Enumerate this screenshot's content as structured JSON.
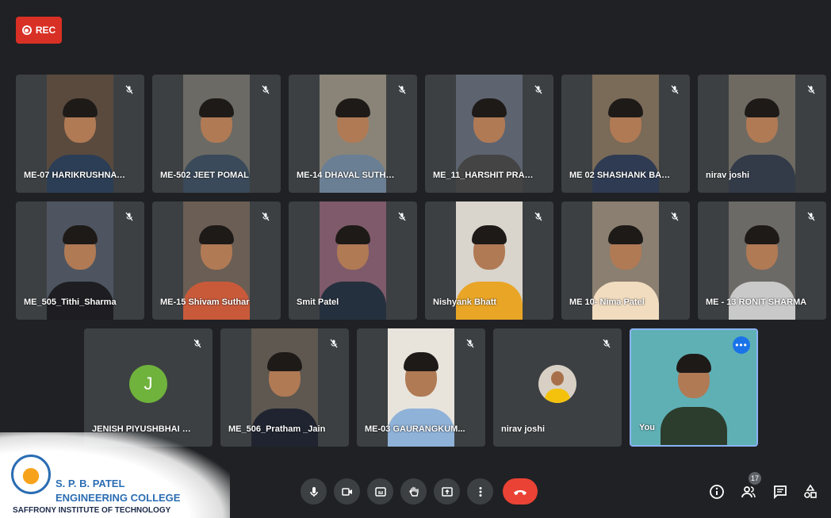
{
  "recording": {
    "label": "REC"
  },
  "participants": [
    {
      "name": "ME-07 HARIKRUSHNA ...",
      "muted": true,
      "video": true
    },
    {
      "name": "ME-502 JEET POMAL",
      "muted": true,
      "video": true
    },
    {
      "name": "ME-14 DHAVAL SUTHAR",
      "muted": true,
      "video": true
    },
    {
      "name": "ME_11_HARSHIT PRAJA...",
      "muted": true,
      "video": true
    },
    {
      "name": "ME 02 SHASHANK BAR...",
      "muted": true,
      "video": true
    },
    {
      "name": "nirav joshi",
      "muted": true,
      "video": true
    },
    {
      "name": "ME_505_Tithi_Sharma",
      "muted": true,
      "video": true
    },
    {
      "name": "ME-15 Shivam Suthar",
      "muted": true,
      "video": true
    },
    {
      "name": "Smit Patel",
      "muted": true,
      "video": true
    },
    {
      "name": "Nishyank Bhatt",
      "muted": true,
      "video": true
    },
    {
      "name": "ME 10- Nima Patel",
      "muted": true,
      "video": true
    },
    {
      "name": "ME - 13 RONIT SHARMA",
      "muted": true,
      "video": true
    },
    {
      "name": "JENISH PIYUSHBHAI DA...",
      "muted": true,
      "video": false,
      "avatar_letter": "J"
    },
    {
      "name": "ME_506_Pratham _Jain",
      "muted": true,
      "video": true
    },
    {
      "name": "ME-03 GAURANGKUM...",
      "muted": true,
      "video": true
    },
    {
      "name": "nirav joshi",
      "muted": true,
      "video": false,
      "avatar_photo": true
    },
    {
      "name": "You",
      "muted": false,
      "video": true,
      "self": true
    }
  ],
  "controls": [
    {
      "name": "mic-button",
      "icon": "microphone-icon"
    },
    {
      "name": "camera-button",
      "icon": "camera-icon"
    },
    {
      "name": "captions-button",
      "icon": "captions-icon"
    },
    {
      "name": "raise-hand-button",
      "icon": "hand-icon"
    },
    {
      "name": "present-button",
      "icon": "present-icon"
    },
    {
      "name": "more-options-button",
      "icon": "more-vert-icon"
    },
    {
      "name": "end-call-button",
      "icon": "end-call-icon"
    }
  ],
  "right_controls": {
    "people_count": "17",
    "icons": [
      "info-icon",
      "people-icon",
      "chat-icon",
      "activities-icon"
    ]
  },
  "colors": {
    "background": "#202124",
    "tile": "#3c4043",
    "end_call": "#ea4335",
    "rec": "#d93025",
    "self_border": "#8ab4f8"
  },
  "watermark": {
    "line1": "S. P. B. PATEL",
    "line2": "ENGINEERING COLLEGE",
    "line3": "SAFFRONY INSTITUTE OF TECHNOLOGY"
  }
}
